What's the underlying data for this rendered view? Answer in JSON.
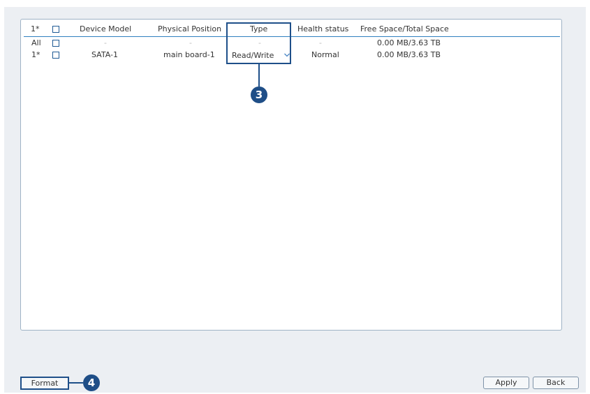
{
  "table": {
    "headers": {
      "index": "1*",
      "device_model": "Device Model",
      "physical_position": "Physical Position",
      "type": "Type",
      "health_status": "Health status",
      "space": "Free Space/Total Space"
    },
    "rows": [
      {
        "index": "All",
        "device_model": "-",
        "physical_position": "-",
        "type": "-",
        "health_status": "-",
        "space": "0.00 MB/3.63 TB"
      },
      {
        "index": "1*",
        "device_model": "SATA-1",
        "physical_position": "main board-1",
        "type": "Read/Write",
        "health_status": "Normal",
        "space": "0.00 MB/3.63 TB"
      }
    ]
  },
  "callouts": {
    "type_marker": "3",
    "format_marker": "4"
  },
  "buttons": {
    "format": "Format",
    "apply": "Apply",
    "back": "Back"
  },
  "colors": {
    "accent": "#1e4f89",
    "header_line": "#2f7fbf",
    "panel_bg": "#eceff3"
  }
}
